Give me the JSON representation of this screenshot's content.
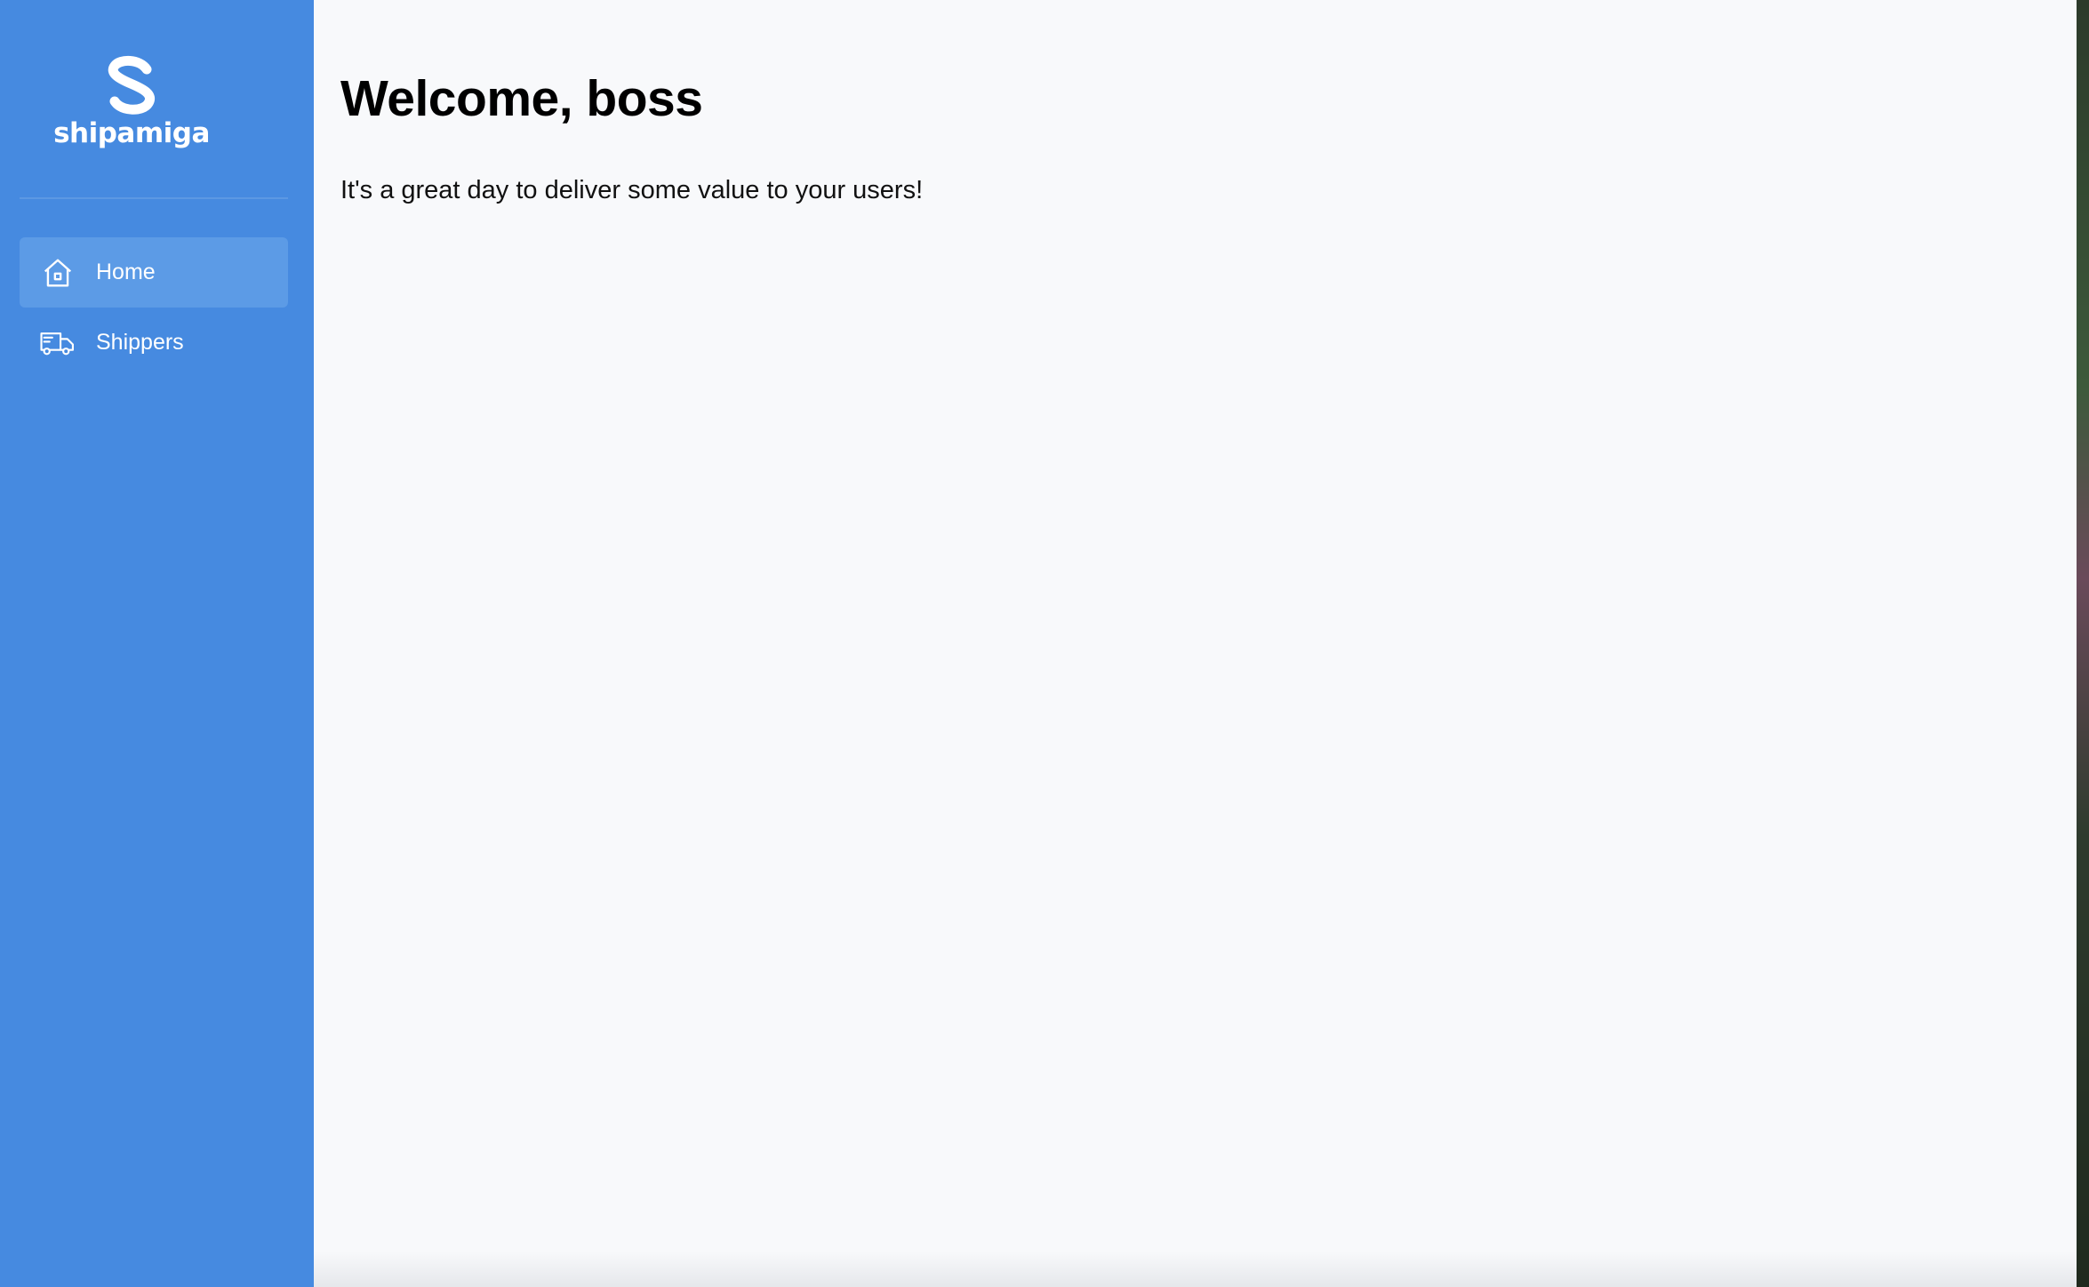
{
  "app": {
    "brand_name": "shipamiga",
    "colors": {
      "sidebar_bg": "#468ae0",
      "active_item_bg": "#5c9be6",
      "main_bg": "#f8f9fb"
    }
  },
  "sidebar": {
    "items": [
      {
        "label": "Home",
        "icon": "home-icon",
        "active": true
      },
      {
        "label": "Shippers",
        "icon": "truck-icon",
        "active": false
      }
    ]
  },
  "main": {
    "title": "Welcome, boss",
    "subtitle": "It's a great day to deliver some value to your users!"
  }
}
